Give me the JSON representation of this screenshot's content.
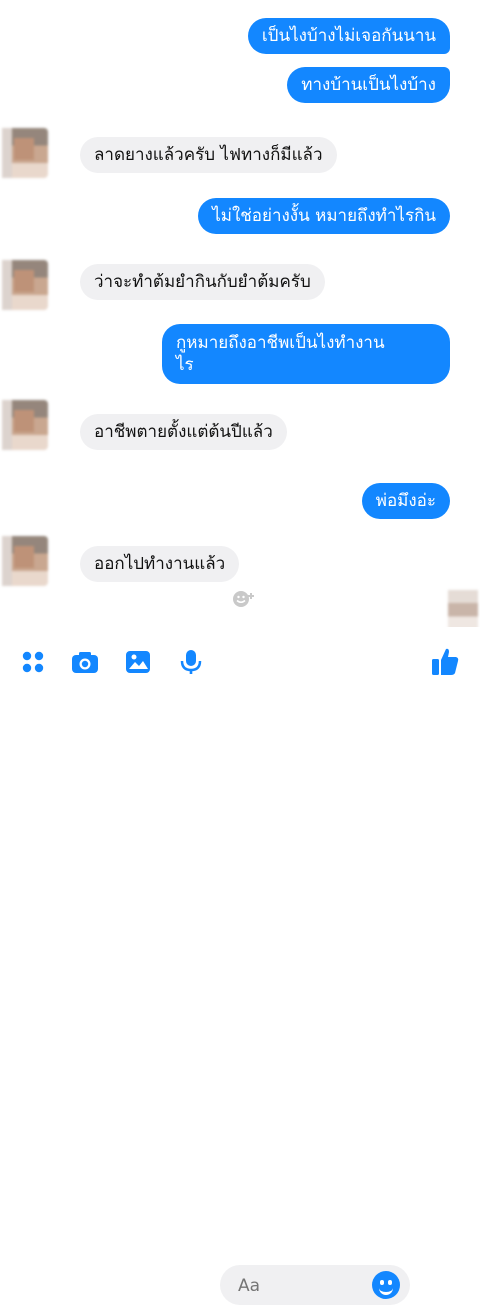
{
  "messages": [
    {
      "text": "เป็นไงบ้างไม่เจอกันนาน",
      "side": "out"
    },
    {
      "text": "ทางบ้านเป็นไงบ้าง",
      "side": "out"
    },
    {
      "text": "ลาดยางแล้วครับ ไฟทางก็มีแล้ว",
      "side": "in"
    },
    {
      "text": "ไม่ใช่อย่างงั้น หมายถึงทำไรกิน",
      "side": "out"
    },
    {
      "text": "ว่าจะทำต้มยำกินกับยำต้มครับ",
      "side": "in"
    },
    {
      "line1": "กูหมายถึงอาชีพเป็นไงทำงาน",
      "line2": "ไร",
      "side": "out"
    },
    {
      "text": "อาชีพตายตั้งแต่ต้นปีแล้ว",
      "side": "in"
    },
    {
      "text": "พ่อมึงอ่ะ",
      "side": "out"
    },
    {
      "text": "ออกไปทำงานแล้ว",
      "side": "in"
    }
  ],
  "composer": {
    "placeholder": "Aa"
  },
  "colors": {
    "outgoing": "#1387ff",
    "incoming": "#f0f0f2",
    "icon": "#1387ff"
  },
  "icons": [
    "apps-icon",
    "camera-icon",
    "gallery-icon",
    "microphone-icon",
    "emoji-icon",
    "like-icon",
    "add-reaction-icon"
  ]
}
